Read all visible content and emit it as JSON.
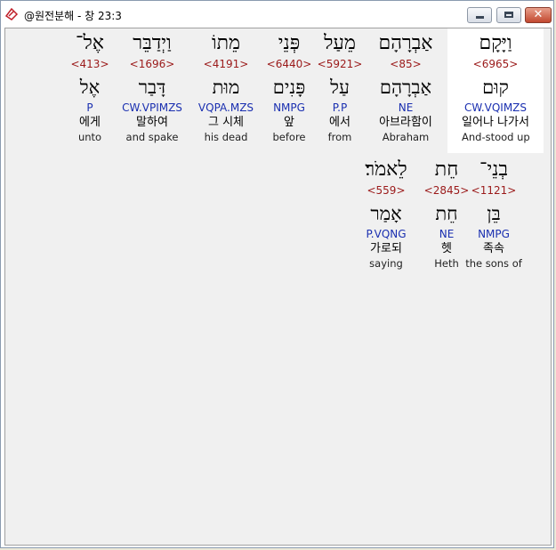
{
  "window": {
    "title": "@원전분해 - 창 23:3",
    "app_icon": "bible-icon",
    "controls": {
      "minimize": "minimize-icon",
      "maximize": "maximize-icon",
      "close": "close-icon"
    },
    "close_glyph": "✕"
  },
  "verse_rows": [
    {
      "words": [
        {
          "hebrew": "וַיָּקָם",
          "strong": "<6965>",
          "lemma": "קוּם",
          "parse": "CW.VQIMZS",
          "korean": "일어나 나가서",
          "english": "And-stood up",
          "highlighted": true
        },
        {
          "hebrew": "אַבְרָהָם",
          "strong": "<85>",
          "lemma": "אַבְרָהָם",
          "parse": "NE",
          "korean": "아브라함이",
          "english": "Abraham"
        },
        {
          "hebrew": "מֵעַל",
          "strong": "<5921>",
          "lemma": "עַל",
          "parse": "P.P",
          "korean": "에서",
          "english": "from"
        },
        {
          "hebrew": "פְּנֵי",
          "strong": "<6440>",
          "lemma": "פָּנִים",
          "parse": "NMPG",
          "korean": "앞",
          "english": "before"
        },
        {
          "hebrew": "מֵתוֹ",
          "strong": "<4191>",
          "lemma": "מוּת",
          "parse": "VQPA.MZS",
          "korean": "그 시체",
          "english": "his dead"
        },
        {
          "hebrew": "וַיְדַבֵּר",
          "strong": "<1696>",
          "lemma": "דָּבַר",
          "parse": "CW.VPIMZS",
          "korean": "말하여",
          "english": "and spake"
        },
        {
          "hebrew": "אֶל־",
          "strong": "<413>",
          "lemma": "אֶל",
          "parse": "P",
          "korean": "에게",
          "english": "unto"
        }
      ]
    },
    {
      "words": [
        {
          "hebrew": "בְנֵי־",
          "strong": "<1121>",
          "lemma": "בֵּן",
          "parse": "NMPG",
          "korean": "족속",
          "english": "the sons of"
        },
        {
          "hebrew": "חֵת",
          "strong": "<2845>",
          "lemma": "חֵת",
          "parse": "NE",
          "korean": "헷",
          "english": "Heth"
        },
        {
          "hebrew": "לֵאמֹר׃",
          "strong": "<559>",
          "lemma": "אָמַר",
          "parse": "P.VQNG",
          "korean": "가로되",
          "english": "saying"
        }
      ]
    }
  ]
}
